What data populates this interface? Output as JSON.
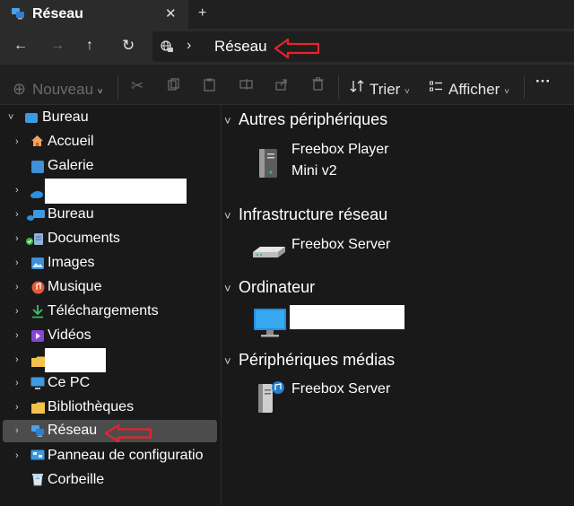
{
  "window": {
    "tab_title": "Réseau",
    "close_glyph": "✕",
    "add_glyph": "+"
  },
  "nav": {
    "back_glyph": "←",
    "forward_glyph": "→",
    "up_glyph": "↑",
    "refresh_glyph": "↻",
    "chevron_glyph": "›",
    "address_text": "Réseau"
  },
  "commandbar": {
    "new_label": "Nouveau",
    "sort_label": "Trier",
    "view_label": "Afficher",
    "more_glyph": "···"
  },
  "sidebar": {
    "items": [
      {
        "label": "Bureau"
      },
      {
        "label": "Accueil"
      },
      {
        "label": "Galerie"
      },
      {
        "label": ""
      },
      {
        "label": "Bureau"
      },
      {
        "label": "Documents"
      },
      {
        "label": "Images"
      },
      {
        "label": "Musique"
      },
      {
        "label": "Téléchargements"
      },
      {
        "label": "Vidéos"
      },
      {
        "label": ""
      },
      {
        "label": "Ce PC"
      },
      {
        "label": "Bibliothèques"
      },
      {
        "label": "Réseau"
      },
      {
        "label": "Panneau de configuratio"
      },
      {
        "label": "Corbeille"
      }
    ]
  },
  "content": {
    "groups": [
      {
        "label": "Autres périphériques",
        "items": [
          {
            "line1": "Freebox Player",
            "line2": "Mini v2"
          }
        ]
      },
      {
        "label": "Infrastructure réseau",
        "items": [
          {
            "line1": "Freebox Server"
          }
        ]
      },
      {
        "label": "Ordinateur",
        "items": [
          {
            "line1": ""
          }
        ]
      },
      {
        "label": "Périphériques médias",
        "items": [
          {
            "line1": "Freebox Server"
          }
        ]
      }
    ]
  },
  "colors": {
    "annotation_red": "#e8232b",
    "selection": "#4c4c4c",
    "background": "#191919"
  }
}
